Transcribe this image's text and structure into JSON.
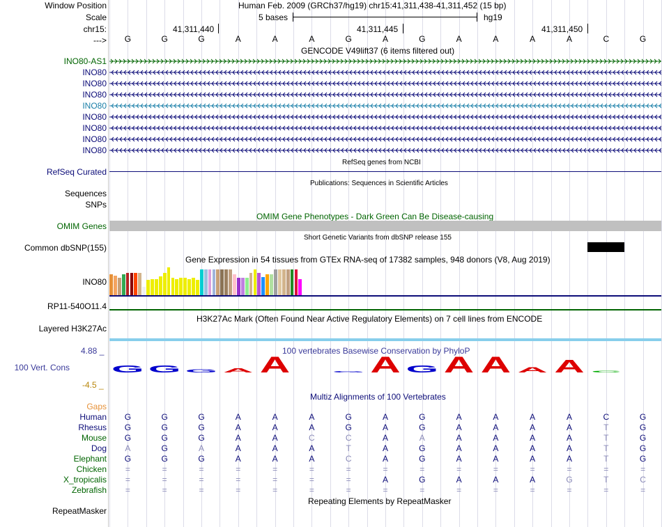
{
  "window_position": {
    "label": "Window Position",
    "text": "Human Feb. 2009 (GRCh37/hg19)   chr15:41,311,438-41,311,452 (15 bp)"
  },
  "scale": {
    "label": "Scale",
    "bases_text": "5 bases",
    "assembly": "hg19"
  },
  "ruler": {
    "chrom_label": "chr15:",
    "ticks": [
      "41,311,440",
      "41,311,445",
      "41,311,450"
    ],
    "strand_label": "--->"
  },
  "sequence": [
    "G",
    "G",
    "G",
    "A",
    "A",
    "A",
    "G",
    "A",
    "G",
    "A",
    "A",
    "A",
    "A",
    "C",
    "G"
  ],
  "gencode": {
    "title": "GENCODE V49lift37 (6 items filtered out)",
    "items": [
      {
        "label": "INO80-AS1",
        "color": "#006400"
      },
      {
        "label": "INO80",
        "color": "#0c0c78"
      },
      {
        "label": "INO80",
        "color": "#0c0c78"
      },
      {
        "label": "INO80",
        "color": "#0c0c78"
      },
      {
        "label": "INO80",
        "color": "#1a7fa8"
      },
      {
        "label": "INO80",
        "color": "#0c0c78"
      },
      {
        "label": "INO80",
        "color": "#0c0c78"
      },
      {
        "label": "INO80",
        "color": "#0c0c78"
      },
      {
        "label": "INO80",
        "color": "#0c0c78"
      }
    ]
  },
  "refseq": {
    "title": "RefSeq genes from NCBI",
    "label": "RefSeq Curated"
  },
  "publications": {
    "title": "Publications: Sequences in Scientific Articles",
    "label1": "Sequences",
    "label2": "SNPs"
  },
  "omim": {
    "title": "OMIM Gene Phenotypes - Dark Green Can Be Disease-causing",
    "label": "OMIM Genes"
  },
  "dbsnp": {
    "title": "Short Genetic Variants from dbSNP release 155",
    "label": "Common dbSNP(155)"
  },
  "gtex": {
    "title": "Gene Expression in 54 tissues from GTEx RNA-seq of 17382 samples, 948 donors (V8, Aug 2019)",
    "label": "INO80",
    "bars": [
      {
        "color": "#e69138",
        "h": 0.69
      },
      {
        "color": "#f4a460",
        "h": 0.64
      },
      {
        "color": "#c8a078",
        "h": 0.56
      },
      {
        "color": "#32a852",
        "h": 0.69
      },
      {
        "color": "#b22222",
        "h": 0.72
      },
      {
        "color": "#8b0000",
        "h": 0.72
      },
      {
        "color": "#ff4500",
        "h": 0.72
      },
      {
        "color": "#d2b48c",
        "h": 0.72
      },
      {
        "color": "#f0f0f0",
        "h": 0.28
      },
      {
        "color": "#eeee00",
        "h": 0.5
      },
      {
        "color": "#eeee00",
        "h": 0.53
      },
      {
        "color": "#eeee00",
        "h": 0.53
      },
      {
        "color": "#eeee00",
        "h": 0.61
      },
      {
        "color": "#eeee00",
        "h": 0.72
      },
      {
        "color": "#eeee00",
        "h": 0.92
      },
      {
        "color": "#eeee00",
        "h": 0.56
      },
      {
        "color": "#eeee00",
        "h": 0.53
      },
      {
        "color": "#eeee00",
        "h": 0.56
      },
      {
        "color": "#eeee00",
        "h": 0.56
      },
      {
        "color": "#eeee00",
        "h": 0.53
      },
      {
        "color": "#eeee00",
        "h": 0.56
      },
      {
        "color": "#eeee00",
        "h": 0.5
      },
      {
        "color": "#00ced1",
        "h": 0.83
      },
      {
        "color": "#9ac0e0",
        "h": 0.83
      },
      {
        "color": "#dda0dd",
        "h": 0.83
      },
      {
        "color": "#a0b4dc",
        "h": 0.83
      },
      {
        "color": "#c8a078",
        "h": 0.83
      },
      {
        "color": "#8b7355",
        "h": 0.83
      },
      {
        "color": "#9c8060",
        "h": 0.83
      },
      {
        "color": "#c0a080",
        "h": 0.83
      },
      {
        "color": "#ffc0cb",
        "h": 0.69
      },
      {
        "color": "#9932cc",
        "h": 0.56
      },
      {
        "color": "#c080e0",
        "h": 0.56
      },
      {
        "color": "#90ee90",
        "h": 0.56
      },
      {
        "color": "#d2b48c",
        "h": 0.72
      },
      {
        "color": "#eeee00",
        "h": 0.83
      },
      {
        "color": "#ba55d3",
        "h": 0.72
      },
      {
        "color": "#1e90ff",
        "h": 0.58
      },
      {
        "color": "#ffa500",
        "h": 0.69
      },
      {
        "color": "#b0e0a0",
        "h": 0.69
      },
      {
        "color": "#a0a0a0",
        "h": 0.83
      },
      {
        "color": "#e0c8a0",
        "h": 0.83
      },
      {
        "color": "#d2b48c",
        "h": 0.83
      },
      {
        "color": "#c0a080",
        "h": 0.83
      },
      {
        "color": "#228b22",
        "h": 0.83
      },
      {
        "color": "#dc143c",
        "h": 0.83
      },
      {
        "color": "#ff00ff",
        "h": 0.53
      }
    ]
  },
  "rp11": {
    "label": "RP11-540O11.4"
  },
  "h3k27ac": {
    "title": "H3K27Ac Mark (Often Found Near Active Regulatory Elements) on 7 cell lines from ENCODE",
    "label": "Layered H3K27Ac"
  },
  "phylop": {
    "title": "100 vertebrates Basewise Conservation by PhyloP",
    "label": "100 Vert. Cons",
    "max": "4.88 _",
    "min": "-4.5 _",
    "letters": [
      {
        "b": "G",
        "s": 0.45,
        "color": "#0000cc"
      },
      {
        "b": "G",
        "s": 0.45,
        "color": "#0000cc"
      },
      {
        "b": "G",
        "s": 0.2,
        "color": "#0000cc"
      },
      {
        "b": "A",
        "s": 0.25,
        "color": "#dd0000"
      },
      {
        "b": "A",
        "s": 1.0,
        "color": "#dd0000"
      },
      {
        "b": "A",
        "s": 0.0,
        "color": "#dd0000"
      },
      {
        "b": "G",
        "s": 0.05,
        "color": "#0000cc"
      },
      {
        "b": "A",
        "s": 1.0,
        "color": "#dd0000"
      },
      {
        "b": "G",
        "s": 0.45,
        "color": "#0000cc"
      },
      {
        "b": "A",
        "s": 1.0,
        "color": "#dd0000"
      },
      {
        "b": "A",
        "s": 1.0,
        "color": "#dd0000"
      },
      {
        "b": "A",
        "s": 0.35,
        "color": "#dd0000"
      },
      {
        "b": "A",
        "s": 0.8,
        "color": "#dd0000"
      },
      {
        "b": "C",
        "s": 0.1,
        "color": "#00aa00"
      },
      {
        "b": "G",
        "s": 0.0,
        "color": "#0000cc"
      }
    ]
  },
  "multiz": {
    "title": "Multiz Alignments of 100 Vertebrates",
    "gaps_label": "Gaps",
    "species": [
      {
        "name": "Human",
        "color": "#0c0c78",
        "row": [
          "G",
          "G",
          "G",
          "A",
          "A",
          "A",
          "G",
          "A",
          "G",
          "A",
          "A",
          "A",
          "A",
          "C",
          "G"
        ]
      },
      {
        "name": "Rhesus",
        "color": "#0c0c78",
        "row": [
          "G",
          "G",
          "G",
          "A",
          "A",
          "A",
          "G",
          "A",
          "G",
          "A",
          "A",
          "A",
          "A",
          "T",
          "G"
        ]
      },
      {
        "name": "Mouse",
        "color": "#006400",
        "row": [
          "G",
          "G",
          "G",
          "A",
          "A",
          "C",
          "C",
          "A",
          "A",
          "A",
          "A",
          "A",
          "A",
          "T",
          "G"
        ]
      },
      {
        "name": "Dog",
        "color": "#0c0c78",
        "row": [
          "A",
          "G",
          "A",
          "A",
          "A",
          "A",
          "T",
          "A",
          "G",
          "A",
          "A",
          "A",
          "A",
          "T",
          "G"
        ]
      },
      {
        "name": "Elephant",
        "color": "#006400",
        "row": [
          "G",
          "G",
          "G",
          "A",
          "A",
          "A",
          "C",
          "A",
          "G",
          "A",
          "A",
          "A",
          "A",
          "T",
          "G"
        ]
      },
      {
        "name": "Chicken",
        "color": "#006400",
        "row": [
          "=",
          "=",
          "=",
          "=",
          "=",
          "=",
          "=",
          "=",
          "=",
          "=",
          "=",
          "=",
          "=",
          "=",
          "="
        ]
      },
      {
        "name": "X_tropicalis",
        "color": "#006400",
        "row": [
          "=",
          "=",
          "=",
          "=",
          "=",
          "=",
          "=",
          "A",
          "G",
          "A",
          "A",
          "A",
          "G",
          "T",
          "C"
        ]
      },
      {
        "name": "Zebrafish",
        "color": "#006400",
        "row": [
          "=",
          "=",
          "=",
          "=",
          "=",
          "=",
          "=",
          "=",
          "=",
          "=",
          "=",
          "=",
          "=",
          "=",
          "="
        ]
      }
    ]
  },
  "repeatmasker": {
    "title": "Repeating Elements by RepeatMasker",
    "label": "RepeatMasker"
  }
}
